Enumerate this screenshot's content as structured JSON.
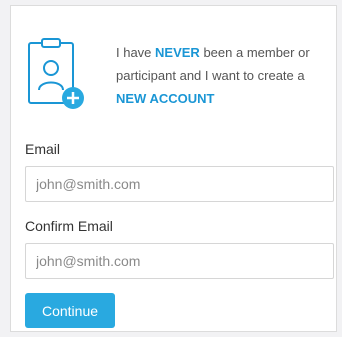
{
  "intro": {
    "line1_prefix": "I have ",
    "line1_highlight": "NEVER",
    "line1_suffix": " been a member or",
    "line2": "participant and I want to create a",
    "line3_highlight": "NEW ACCOUNT"
  },
  "form": {
    "email_label": "Email",
    "email_placeholder": "john@smith.com",
    "confirm_label": "Confirm Email",
    "confirm_placeholder": "john@smith.com",
    "continue_label": "Continue"
  },
  "colors": {
    "accent": "#1a96d5",
    "button": "#29a9e0"
  },
  "icons": {
    "intro_icon": "clipboard-user-plus-icon"
  }
}
